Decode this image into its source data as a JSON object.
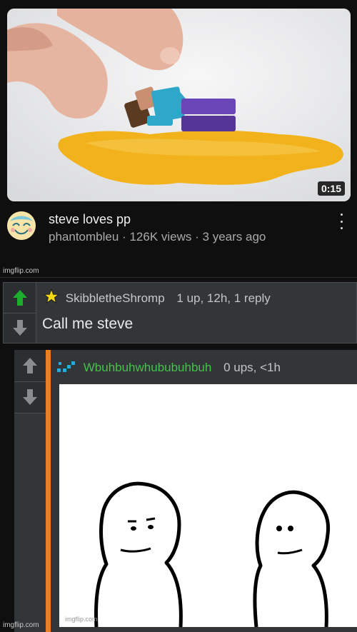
{
  "video": {
    "title": "steve loves pp",
    "channel": "phantombleu",
    "views": "126K views",
    "age": "3 years ago",
    "separator": "·",
    "duration": "0:15",
    "thumbnail_subject": "lego-minifigure-in-puddle"
  },
  "watermarks": {
    "top": "imgflip.com",
    "bottom": "imgflip.com",
    "meme": "imgflip.com"
  },
  "comment_1": {
    "username": "SkibbletheShromp",
    "stats": "1 up, 12h, 1 reply",
    "text": "Call me steve",
    "badge_icon": "star-icon",
    "upvote_color": "#1cad2c"
  },
  "comment_2": {
    "username": "Wbuhbuhwhububuhbuh",
    "stats": "0 ups, <1h",
    "username_color": "#47c14a",
    "reply_bar_color": "#ee7e1e",
    "image_subject": "two-blank-faced-figures-meme"
  }
}
